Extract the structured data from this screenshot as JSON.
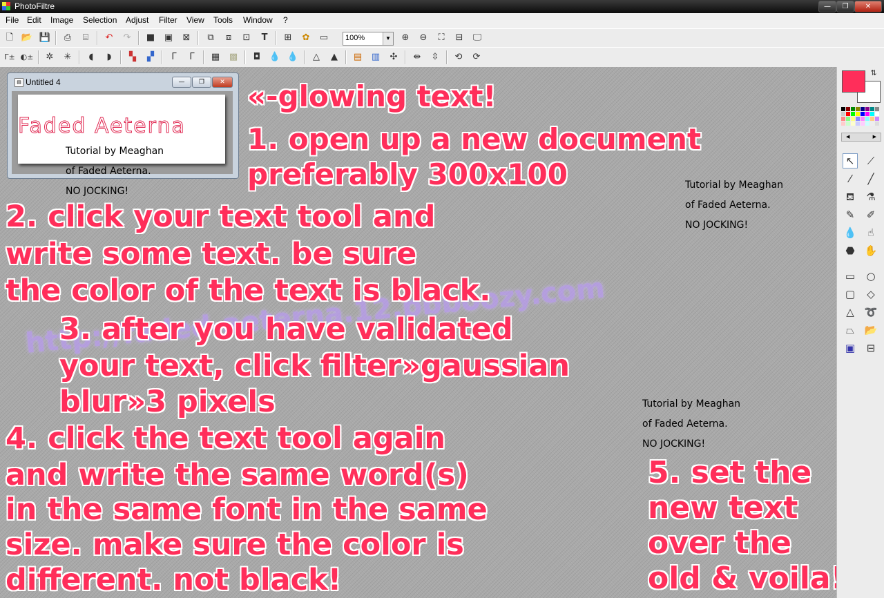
{
  "app": {
    "title": "PhotoFiltre"
  },
  "window_controls": {
    "minimize": "—",
    "maximize": "❐",
    "close": "✕"
  },
  "menu": [
    "File",
    "Edit",
    "Image",
    "Selection",
    "Adjust",
    "Filter",
    "View",
    "Tools",
    "Window",
    "?"
  ],
  "toolbar": {
    "zoom_value": "100%"
  },
  "document": {
    "title": "Untitled 4",
    "image_text": "Faded Aeterna"
  },
  "canvas": {
    "heading": "«-glowing text!",
    "step1": [
      "1. open up a new document",
      "preferably 300x100"
    ],
    "step2": [
      "2. click your text tool and",
      "write some text. be sure",
      "the color of the text is black."
    ],
    "step3": [
      "3. after you have validated",
      "your text, click filter»gaussian",
      "blur»3 pixels"
    ],
    "step4": [
      "4. click the text tool again",
      "and write the same word(s)",
      "in the same font in the same",
      "size. make sure the color is",
      "different. not black!"
    ],
    "step5": [
      "5. set the",
      "new text",
      "over the",
      "old & voila!"
    ],
    "credit": [
      "Tutorial by Meaghan",
      "of Faded Aeterna.",
      "NO JOCKING!"
    ],
    "watermark": "http://faded-aeterna.12.bbboozy.com"
  },
  "colors": {
    "foreground": "#ff2e5a",
    "background": "#ffffff",
    "text_outline": "#ffffff",
    "watermark": "#b99cf0"
  },
  "palette_tools": [
    "selection-arrow",
    "eyedropper",
    "magic-wand",
    "line",
    "fill-bucket",
    "spray",
    "brush",
    "smudge",
    "blur-drop",
    "clone-finger",
    "stamp",
    "hand",
    "rectangle",
    "ellipse",
    "rounded-rectangle",
    "diamond",
    "triangle",
    "lasso",
    "polygon-lasso",
    "open-folder",
    "selection-frame",
    "text-frame"
  ]
}
